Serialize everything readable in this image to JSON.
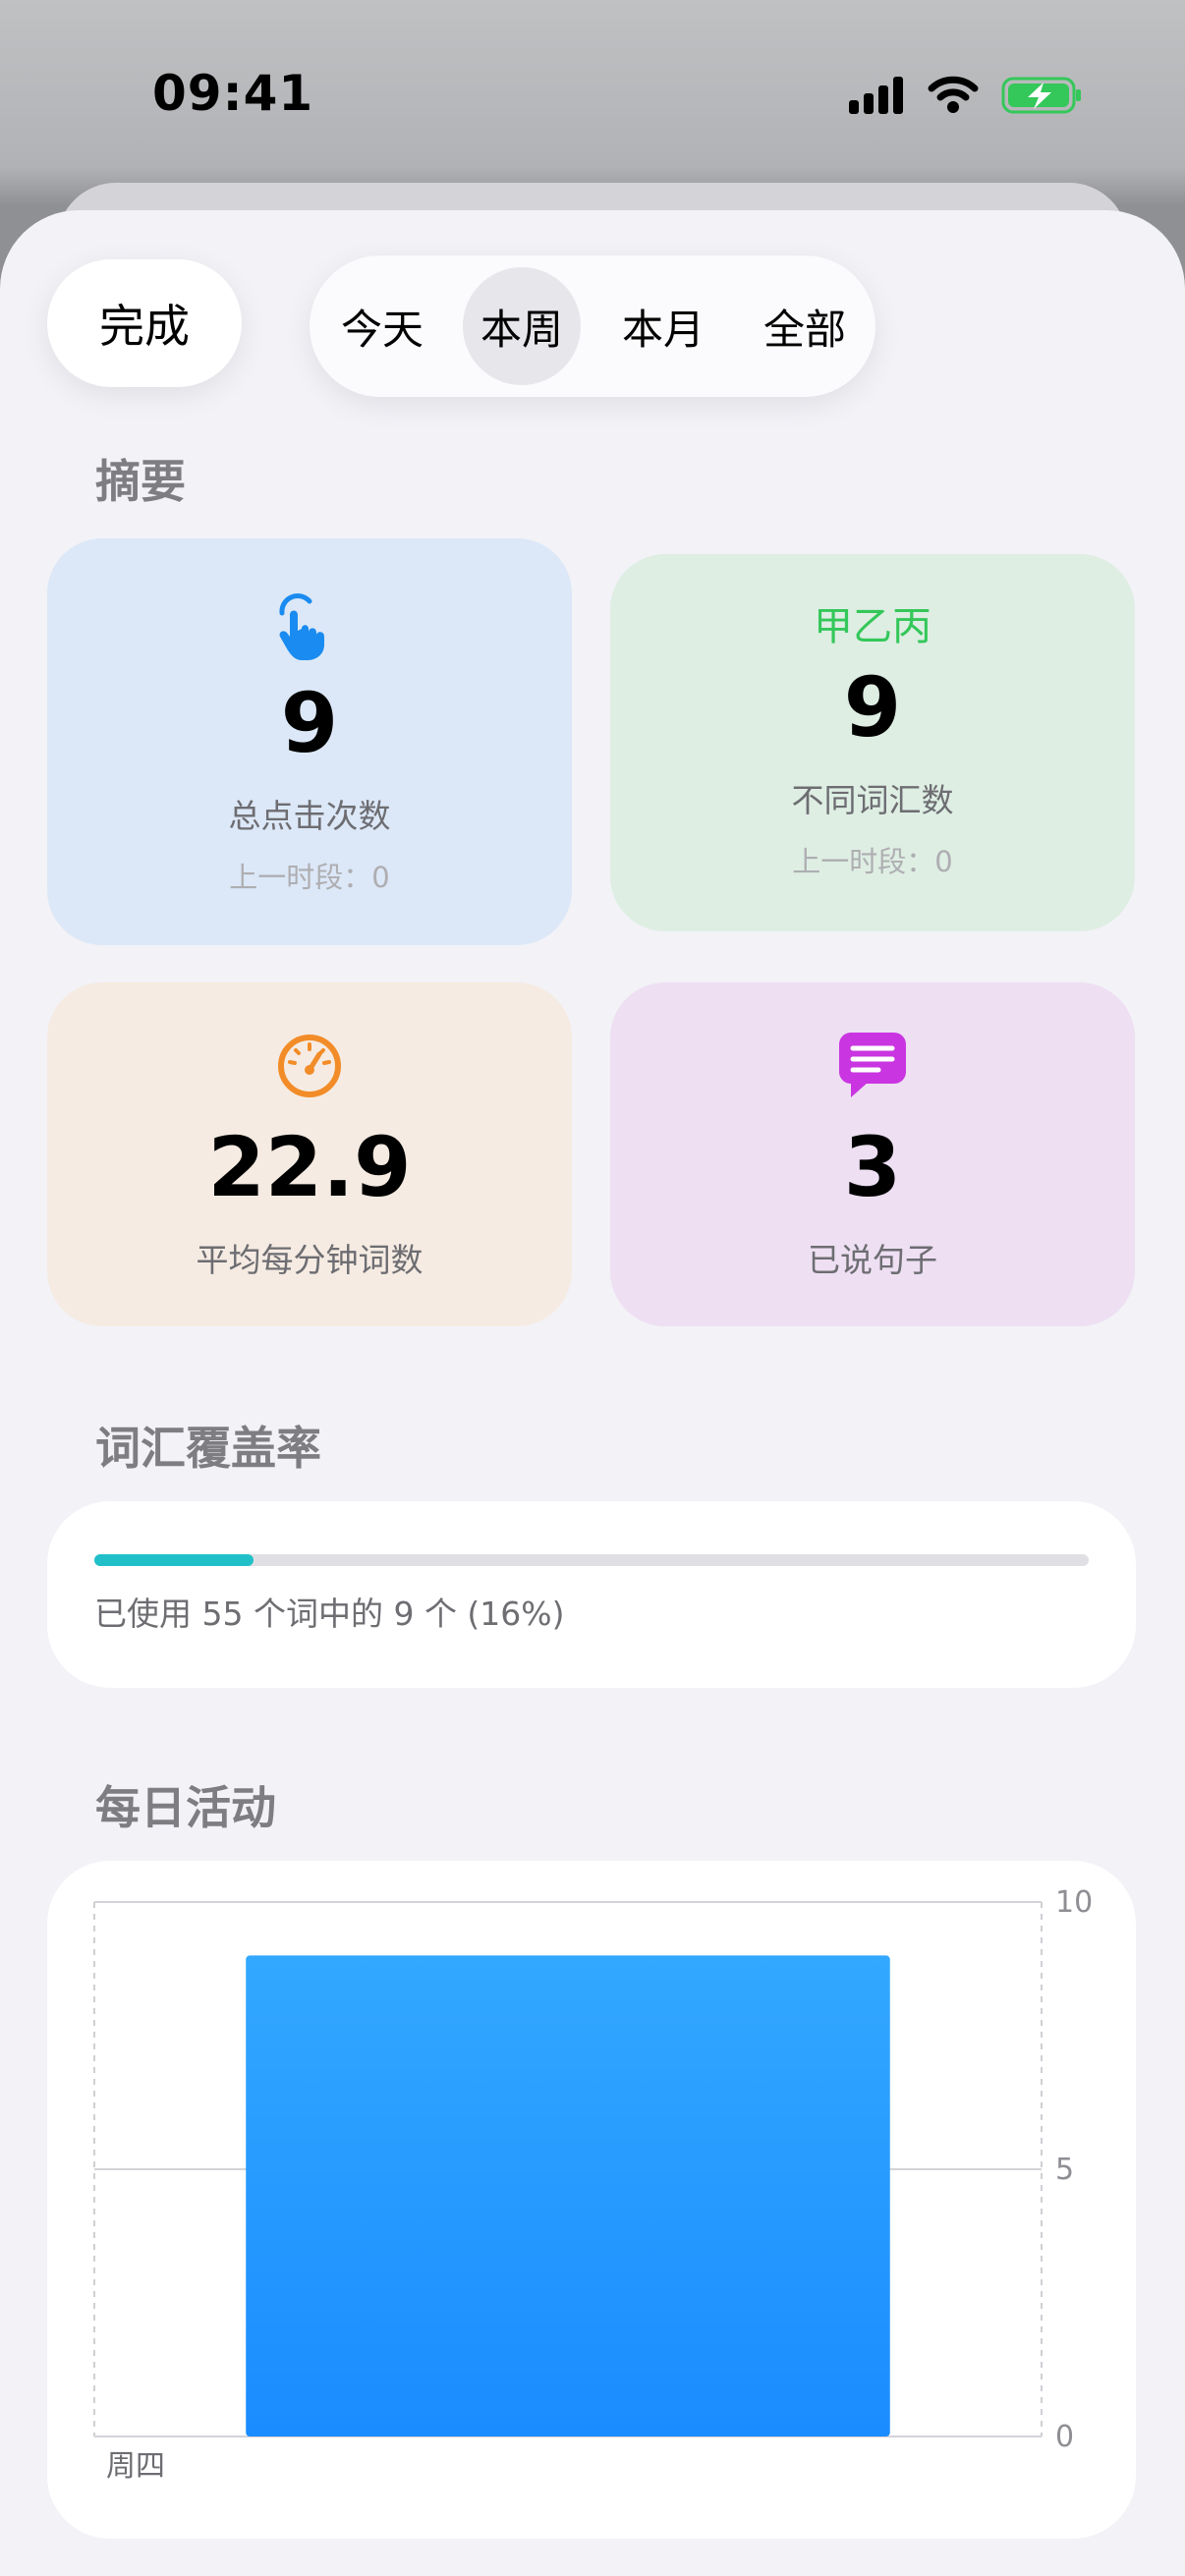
{
  "status_bar": {
    "time": "09:41"
  },
  "header": {
    "done_label": "完成",
    "segments": [
      {
        "label": "今天",
        "active": false
      },
      {
        "label": "本周",
        "active": true
      },
      {
        "label": "本月",
        "active": false
      },
      {
        "label": "全部",
        "active": false
      }
    ]
  },
  "summary": {
    "title": "摘要",
    "cards": [
      {
        "icon": "hand-tap-icon",
        "value": "9",
        "label": "总点击次数",
        "previous": "上一时段：0",
        "background": "#dce8f7",
        "accent": "#1a8bf0"
      },
      {
        "icon_text": "甲乙丙",
        "value": "9",
        "label": "不同词汇数",
        "previous": "上一时段：0",
        "background": "#deeee3",
        "accent": "#34c759"
      },
      {
        "icon": "speedometer-icon",
        "value": "22.9",
        "label": "平均每分钟词数",
        "background": "#f5ebe2",
        "accent": "#f28c28"
      },
      {
        "icon": "speech-bubble-icon",
        "value": "3",
        "label": "已说句子",
        "background": "#eedff3",
        "accent": "#c935e0"
      }
    ]
  },
  "coverage": {
    "title": "词汇覆盖率",
    "progress_fraction": 0.16,
    "text": "已使用 55 个词中的 9 个 (16%)",
    "accent": "#21c0c9"
  },
  "daily_activity": {
    "title": "每日活动",
    "chart_data": {
      "type": "bar",
      "categories": [
        "周四"
      ],
      "values": [
        9
      ],
      "ylim": [
        0,
        10
      ],
      "yticks": [
        0,
        5,
        10
      ],
      "bar_color": "#1a8cff",
      "grid": true
    }
  }
}
